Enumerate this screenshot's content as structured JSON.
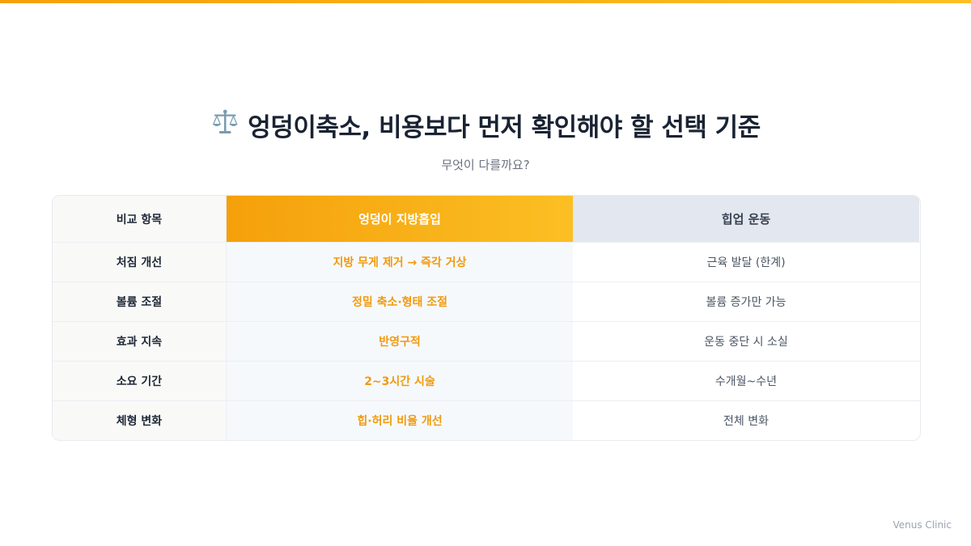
{
  "title": "엉덩이축소, 비용보다 먼저 확인해야 할 선택 기준",
  "title_icon": "balance-scale-icon",
  "subtitle": "무엇이 다를까요?",
  "table": {
    "headers": [
      "비교 항목",
      "엉덩이 지방흡입",
      "힙업 운동"
    ],
    "rows": [
      [
        "처짐 개선",
        "지방 무게 제거 → 즉각 거상",
        "근육 발달 (한계)"
      ],
      [
        "볼륨 조절",
        "정밀 축소·형태 조절",
        "볼륨 증가만 가능"
      ],
      [
        "효과 지속",
        "반영구적",
        "운동 중단 시 소실"
      ],
      [
        "소요 기간",
        "2~3시간 시술",
        "수개월~수년"
      ],
      [
        "체형 변화",
        "힙·허리 비율 개선",
        "전체 변화"
      ]
    ]
  },
  "brand": "Venus Clinic",
  "colors": {
    "accent": "#f5a00b",
    "accent_end": "#fbbf24",
    "title": "#1a2333",
    "highlight_text": "#f19a0e",
    "compare_header_bg": "#e3e7ef"
  }
}
